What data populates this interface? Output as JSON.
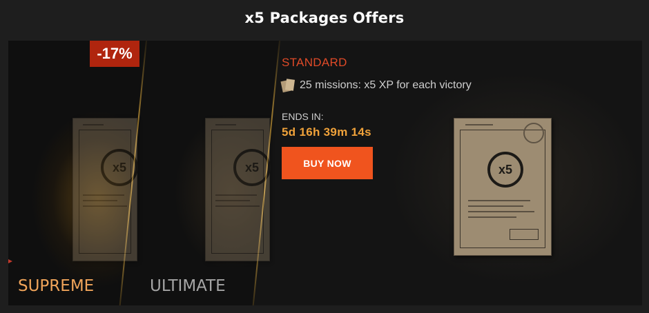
{
  "page": {
    "title": "x5 Packages Offers"
  },
  "offers": {
    "discount": "-17%",
    "supreme": {
      "label": "SUPREME",
      "stamp": "x5"
    },
    "ultimate": {
      "label": "ULTIMATE",
      "stamp": "x5"
    },
    "standard": {
      "label": "STANDARD",
      "stamp": "x5",
      "mission_text": "25 missions: x5 XP for each victory",
      "ends_label": "ENDS IN:",
      "countdown": "5d 16h 39m 14s",
      "buy_label": "BUY NOW"
    }
  },
  "icons": {
    "missions": "document-stack-icon",
    "package": "document-icon",
    "nav": "left-arrow-icon"
  },
  "colors": {
    "accent": "#f0541e",
    "standard_title": "#e04a28",
    "countdown": "#f0a23a",
    "supreme": "#f0a45a",
    "ultimate": "#a5a5a5",
    "discount_badge": "#b0250e"
  }
}
